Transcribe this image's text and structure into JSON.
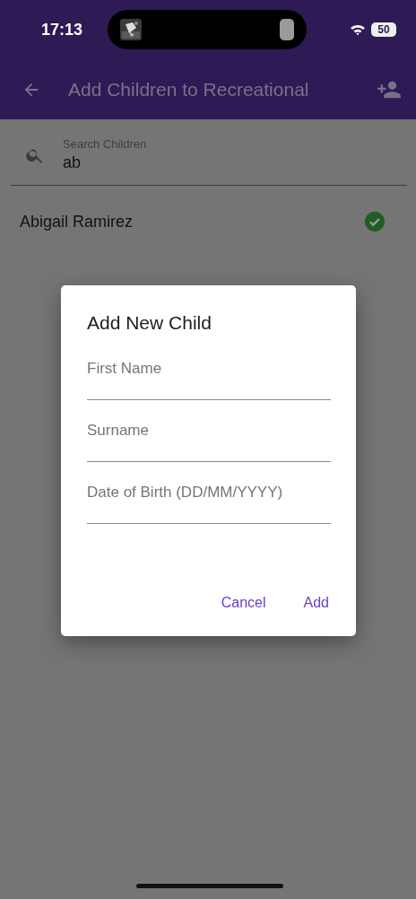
{
  "status_bar": {
    "time": "17:13",
    "battery": "50"
  },
  "app_bar": {
    "title": "Add Children to Recreational"
  },
  "search": {
    "label": "Search Children",
    "value": "ab"
  },
  "children": [
    {
      "name": "Abigail Ramirez",
      "selected": true
    }
  ],
  "dialog": {
    "title": "Add New Child",
    "fields": [
      {
        "placeholder": "First Name"
      },
      {
        "placeholder": "Surname"
      },
      {
        "placeholder": "Date of Birth (DD/MM/YYYY)"
      }
    ],
    "actions": [
      {
        "label": "Cancel"
      },
      {
        "label": "Add"
      }
    ]
  }
}
